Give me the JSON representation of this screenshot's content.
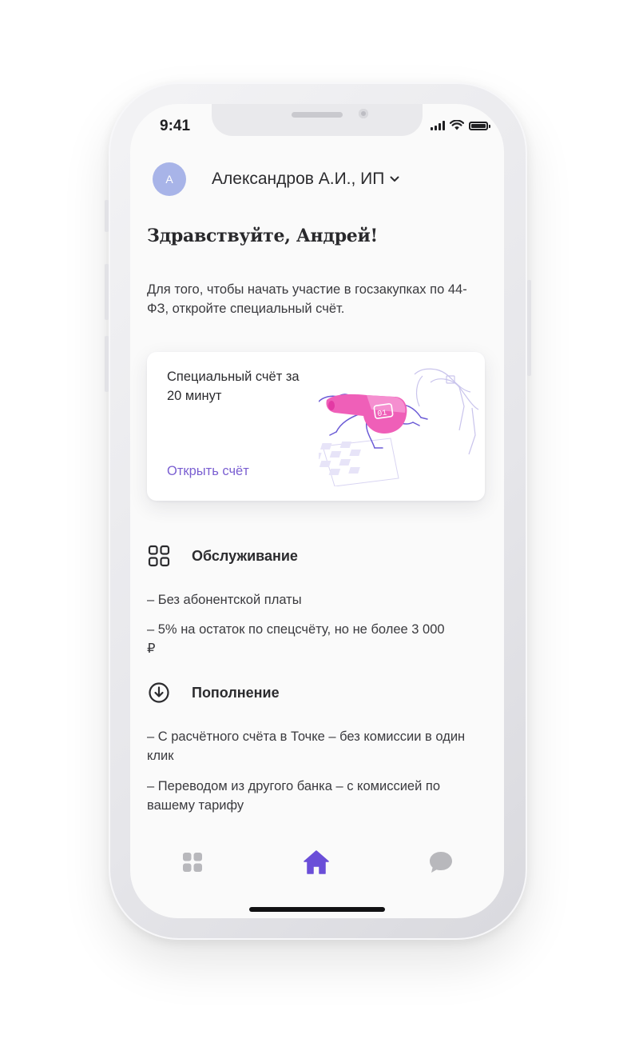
{
  "status_bar": {
    "time": "9:41"
  },
  "account": {
    "avatar_initial": "A",
    "name": "Александров А.И., ИП"
  },
  "greeting": "Здравствуйте, Андрей!",
  "intro": "Для того, чтобы начать участие в госзакупках по 44-ФЗ, откройте специальный счёт.",
  "promo_card": {
    "title": "Специальный счёт за 20 минут",
    "link": "Открыть счёт",
    "illustration_badge": "01"
  },
  "sections": [
    {
      "title": "Обслуживание",
      "icon": "grid-icon",
      "items": [
        "– Без абонентской платы",
        "– 5% на остаток по спецсчёту, но не более 3 000 ₽"
      ]
    },
    {
      "title": "Пополнение",
      "icon": "download-circle-icon",
      "items": [
        "– С расчётного счёта в Точке – без комиссии в один клик",
        "– Переводом из другого банка – с комиссией по вашему тарифу"
      ]
    }
  ],
  "tabbar": {
    "items": [
      {
        "icon": "apps-icon",
        "active": false
      },
      {
        "icon": "home-icon",
        "active": true
      },
      {
        "icon": "chat-icon",
        "active": false
      }
    ]
  },
  "colors": {
    "accent": "#7a5fd1",
    "home_active": "#6a4ed8",
    "avatar": "#a8b4e8",
    "tab_inactive": "#b8b8bc",
    "whistle": "#ef5fb8"
  }
}
